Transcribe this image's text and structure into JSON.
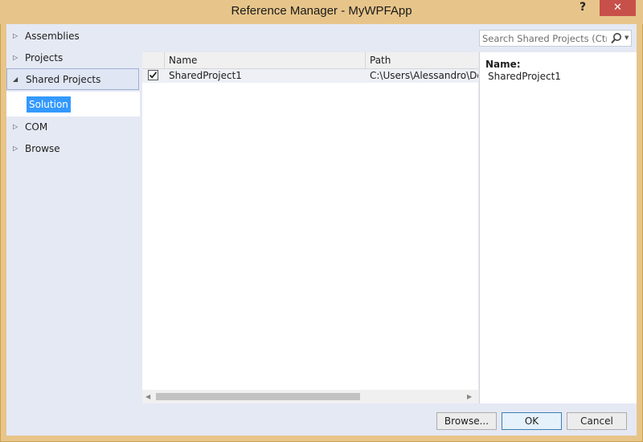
{
  "window": {
    "title": "Reference Manager - MyWPFApp",
    "help_label": "?",
    "close_label": "✕"
  },
  "nav": {
    "items": [
      {
        "label": "Assemblies",
        "expanded": false
      },
      {
        "label": "Projects",
        "expanded": false
      },
      {
        "label": "Shared Projects",
        "expanded": true,
        "selected": true
      },
      {
        "label": "COM",
        "expanded": false
      },
      {
        "label": "Browse",
        "expanded": false
      }
    ],
    "sub_item": "Solution"
  },
  "search": {
    "placeholder": "Search Shared Projects (Ctrl+E)"
  },
  "grid": {
    "columns": [
      "Name",
      "Path"
    ],
    "rows": [
      {
        "checked": true,
        "name": "SharedProject1",
        "path": "C:\\Users\\Alessandro\\Documents\\"
      }
    ]
  },
  "details": {
    "label": "Name:",
    "value": "SharedProject1"
  },
  "buttons": {
    "browse": "Browse...",
    "ok": "OK",
    "cancel": "Cancel"
  },
  "colors": {
    "title_bar": "#e7c58a",
    "close_button": "#c7504a",
    "selection": "#3399ff",
    "panel": "#e5e9f4"
  }
}
